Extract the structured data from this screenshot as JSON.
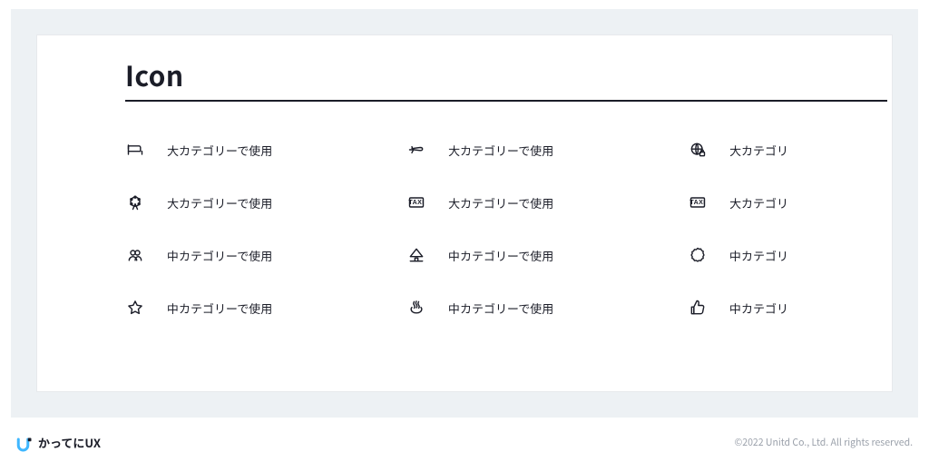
{
  "section_title": "Icon",
  "rows": [
    {
      "cells": [
        {
          "icon": "bed-icon",
          "label": "大カテゴリーで使用"
        },
        {
          "icon": "plane-icon",
          "label": "大カテゴリーで使用"
        },
        {
          "icon": "globe-lock-icon",
          "label": "大カテゴリ"
        }
      ]
    },
    {
      "cells": [
        {
          "icon": "ferris-wheel-icon",
          "label": "大カテゴリーで使用"
        },
        {
          "icon": "taxi-icon",
          "label": "大カテゴリーで使用"
        },
        {
          "icon": "taxi-icon",
          "label": "大カテゴリ"
        }
      ]
    },
    {
      "cells": [
        {
          "icon": "people-icon",
          "label": "中カテゴリーで使用"
        },
        {
          "icon": "hut-icon",
          "label": "中カテゴリーで使用"
        },
        {
          "icon": "badge-icon",
          "label": "中カテゴリ"
        }
      ]
    },
    {
      "cells": [
        {
          "icon": "star-icon",
          "label": "中カテゴリーで使用"
        },
        {
          "icon": "onsen-icon",
          "label": "中カテゴリーで使用"
        },
        {
          "icon": "thumbs-up-icon",
          "label": "中カテゴリ"
        }
      ]
    },
    {
      "cells": [
        {
          "icon": "blank-icon",
          "label": ""
        },
        {
          "icon": "blank-icon",
          "label": ""
        },
        {
          "icon": "blank-icon",
          "label": ""
        }
      ]
    }
  ],
  "brand_text": "かってにUX",
  "copyright": "©2022 Unitd Co., Ltd. All rights reserved."
}
